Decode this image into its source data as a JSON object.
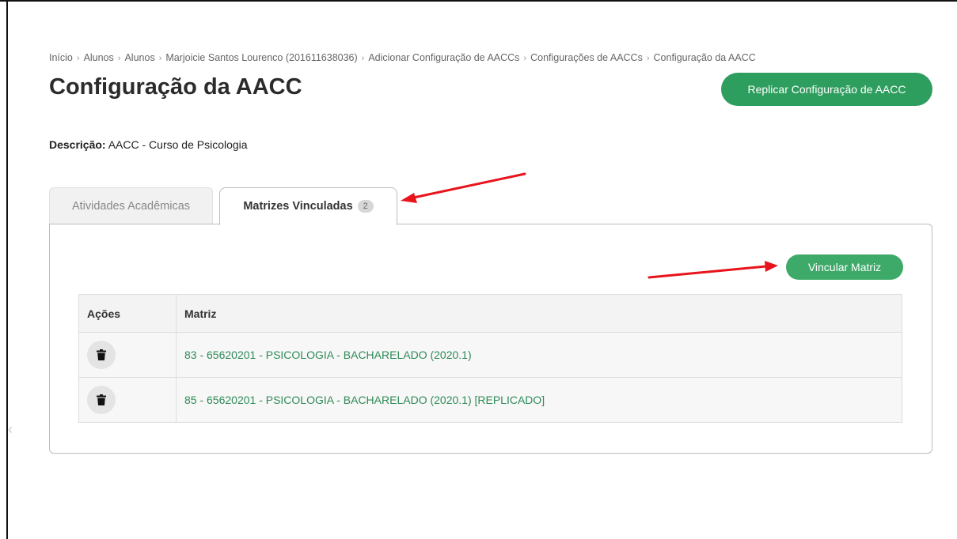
{
  "breadcrumb": [
    "Início",
    "Alunos",
    "Alunos",
    "Marjoicie Santos Lourenco (201611638036)",
    "Adicionar Configuração de AACCs",
    "Configurações de AACCs",
    "Configuração da AACC"
  ],
  "breadcrumb_separator": "›",
  "page": {
    "title": "Configuração da AACC",
    "replicate_button": "Replicar Configuração de AACC",
    "description_label": "Descrição:",
    "description_value": "AACC - Curso de Psicologia"
  },
  "tabs": [
    {
      "label": "Atividades Acadêmicas",
      "active": false
    },
    {
      "label": "Matrizes Vinculadas",
      "badge": "2",
      "active": true
    }
  ],
  "panel": {
    "link_button": "Vincular Matriz",
    "table": {
      "headers": [
        "Ações",
        "Matriz"
      ],
      "rows": [
        {
          "matriz": "83 - 65620201 - PSICOLOGIA - BACHARELADO (2020.1)",
          "action_icon": "trash-icon"
        },
        {
          "matriz": "85 - 65620201 - PSICOLOGIA - BACHARELADO (2020.1) [REPLICADO]",
          "action_icon": "trash-icon"
        }
      ]
    }
  },
  "colors": {
    "primary_green": "#2e9e5e",
    "link_green": "#2e8b57",
    "annotation_arrow": "#e8141b"
  },
  "side_icon": "chevron-left-icon"
}
